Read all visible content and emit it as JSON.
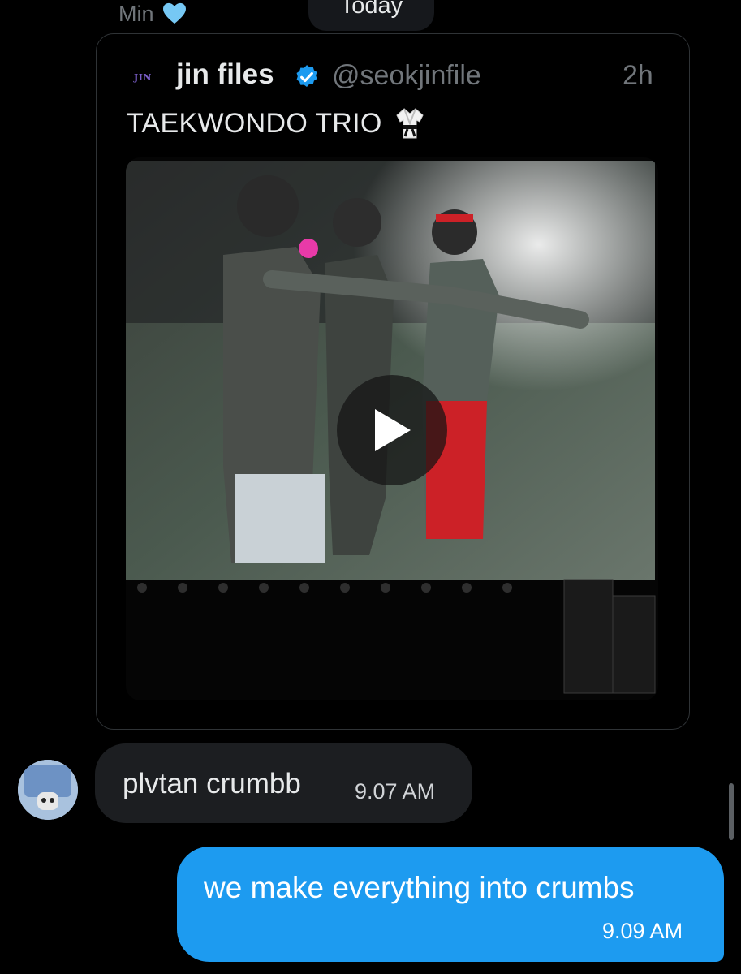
{
  "header": {
    "contact_name": "Min",
    "date_divider": "Today"
  },
  "tweet": {
    "avatar_text": "JIN",
    "display_name": "jin files",
    "handle": "@seokjinfile",
    "time": "2h",
    "text": "TAEKWONDO TRIO",
    "emoji_icon": "martial-arts-uniform-icon",
    "media_type": "video"
  },
  "messages": [
    {
      "direction": "incoming",
      "text": "plvtan crumbb",
      "time": "9.07 AM"
    },
    {
      "direction": "outgoing",
      "text": "we make everything into crumbs",
      "time": "9.09 AM"
    }
  ],
  "colors": {
    "background": "#000000",
    "outgoing_bubble": "#1d9bf0",
    "incoming_bubble": "#1c1e21",
    "verified": "#1d9bf0",
    "heart": "#76c8f4"
  }
}
